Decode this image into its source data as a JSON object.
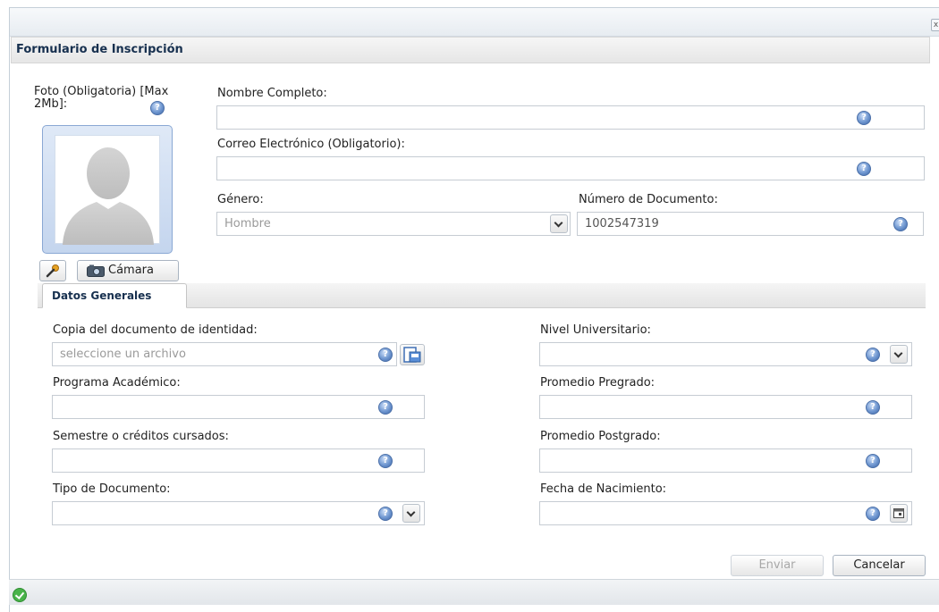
{
  "window": {
    "close_glyph": "x"
  },
  "form": {
    "title": "Formulario de Inscripción",
    "photo_label": "Foto (Obligatoria) [Max 2Mb]:",
    "full_name": {
      "label": "Nombre Completo:",
      "value": ""
    },
    "email": {
      "label": "Correo Electrónico (Obligatorio):",
      "value": ""
    },
    "gender": {
      "label": "Género:",
      "value": "Hombre"
    },
    "document_number": {
      "label": "Número de Documento:",
      "value": "1002547319"
    },
    "camera_button": "Cámara"
  },
  "tabs": [
    {
      "label": "Datos Generales",
      "active": true
    }
  ],
  "general": {
    "id_copy": {
      "label": "Copia del documento de identidad:",
      "placeholder": "seleccione un archivo"
    },
    "academic_program": {
      "label": "Programa Académico:",
      "value": ""
    },
    "semester": {
      "label": "Semestre o créditos cursados:",
      "value": ""
    },
    "document_type": {
      "label": "Tipo de Documento:",
      "value": ""
    },
    "university_level": {
      "label": "Nivel Universitario:",
      "value": ""
    },
    "undergrad_avg": {
      "label": "Promedio Pregrado:",
      "value": ""
    },
    "postgrad_avg": {
      "label": "Promedio Postgrado:",
      "value": ""
    },
    "birth_date": {
      "label": "Fecha de Nacimiento:",
      "value": ""
    }
  },
  "buttons": {
    "submit": "Enviar",
    "cancel": "Cancelar"
  },
  "icons": {
    "help": "help-icon",
    "key": "key-icon",
    "camera": "camera-icon",
    "file_browse": "file-browse-icon",
    "dropdown": "chevron-down-icon",
    "calendar": "calendar-icon",
    "status_ok": "check-circle-icon"
  },
  "colors": {
    "title_text": "#17304f",
    "help_icon": "#4a6fa8",
    "status_ok": "#49b34a",
    "photo_frame": "#8aa8d4"
  }
}
